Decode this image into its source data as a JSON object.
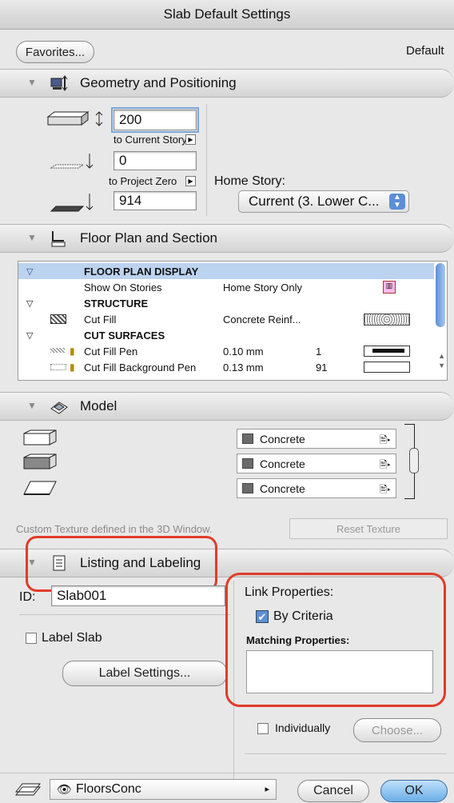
{
  "window": {
    "title": "Slab Default Settings"
  },
  "top": {
    "favorites_label": "Favorites...",
    "default_label": "Default"
  },
  "geometry": {
    "section_title": "Geometry and Positioning",
    "thickness": "200",
    "to_current_story_label": "to Current Story",
    "offset_current": "0",
    "to_project_zero_label": "to Project Zero",
    "offset_zero": "914",
    "home_story_label": "Home Story:",
    "home_story_value": "Current (3. Lower C..."
  },
  "floorplan": {
    "section_title": "Floor Plan and Section",
    "rows": [
      {
        "type": "group",
        "name": "FLOOR PLAN DISPLAY"
      },
      {
        "type": "item",
        "name": "Show On Stories",
        "value": "Home Story Only",
        "num": "",
        "icon": "story-icon"
      },
      {
        "type": "group",
        "name": "STRUCTURE"
      },
      {
        "type": "item",
        "name": "Cut Fill",
        "value": "Concrete Reinf...",
        "num": "",
        "icon": "fill-pattern-swatch"
      },
      {
        "type": "group",
        "name": "CUT SURFACES"
      },
      {
        "type": "item",
        "name": "Cut Fill Pen",
        "value": "0.10 mm",
        "num": "1",
        "icon": "pen-swatch"
      },
      {
        "type": "item",
        "name": "Cut Fill Background Pen",
        "value": "0.13 mm",
        "num": "91",
        "icon": "pen-swatch-empty"
      }
    ]
  },
  "model": {
    "section_title": "Model",
    "materials": [
      "Concrete",
      "Concrete",
      "Concrete"
    ],
    "custom_texture_note": "Custom Texture defined in the 3D Window.",
    "reset_texture_label": "Reset Texture"
  },
  "listing": {
    "section_title": "Listing and Labeling",
    "id_label": "ID:",
    "id_value": "Slab001",
    "label_slab": "Label Slab",
    "label_settings_button": "Label Settings...",
    "link_properties_label": "Link Properties:",
    "by_criteria_label": "By Criteria",
    "matching_properties_label": "Matching Properties:",
    "individually_label": "Individually",
    "choose_button": "Choose..."
  },
  "footer": {
    "layer_value": "FloorsConc",
    "cancel_label": "Cancel",
    "ok_label": "OK"
  },
  "colors": {
    "highlight_red": "#e23b2a",
    "selected_row": "#bcd3ef",
    "ok_blue": "#7cb8ea"
  }
}
